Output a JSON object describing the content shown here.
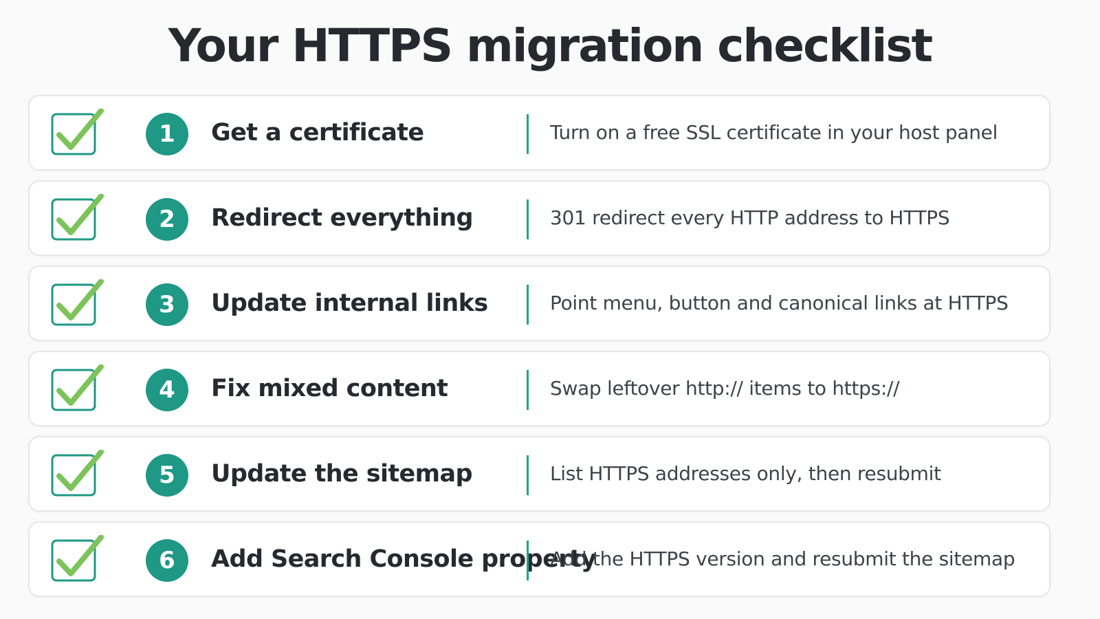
{
  "title": "Your HTTPS migration checklist",
  "colors": {
    "accent_teal": "#1f9886",
    "check_green": "#7cc35a",
    "text_dark": "#262a30"
  },
  "steps": [
    {
      "number": "1",
      "title": "Get a certificate",
      "description": "Turn on a free SSL certificate in your host panel",
      "checked": true,
      "icon": "checked-box-icon"
    },
    {
      "number": "2",
      "title": "Redirect everything",
      "description": "301 redirect every HTTP address to HTTPS",
      "checked": true,
      "icon": "checked-box-icon"
    },
    {
      "number": "3",
      "title": "Update internal links",
      "description": "Point menu, button and canonical links at HTTPS",
      "checked": true,
      "icon": "checked-box-icon"
    },
    {
      "number": "4",
      "title": "Fix mixed content",
      "description": "Swap leftover http:// items to https://",
      "checked": true,
      "icon": "checked-box-icon"
    },
    {
      "number": "5",
      "title": "Update the sitemap",
      "description": "List HTTPS addresses only, then resubmit",
      "checked": true,
      "icon": "checked-box-icon"
    },
    {
      "number": "6",
      "title": "Add Search Console property",
      "description": "Add the HTTPS version and resubmit the sitemap",
      "checked": true,
      "icon": "checked-box-icon"
    }
  ]
}
